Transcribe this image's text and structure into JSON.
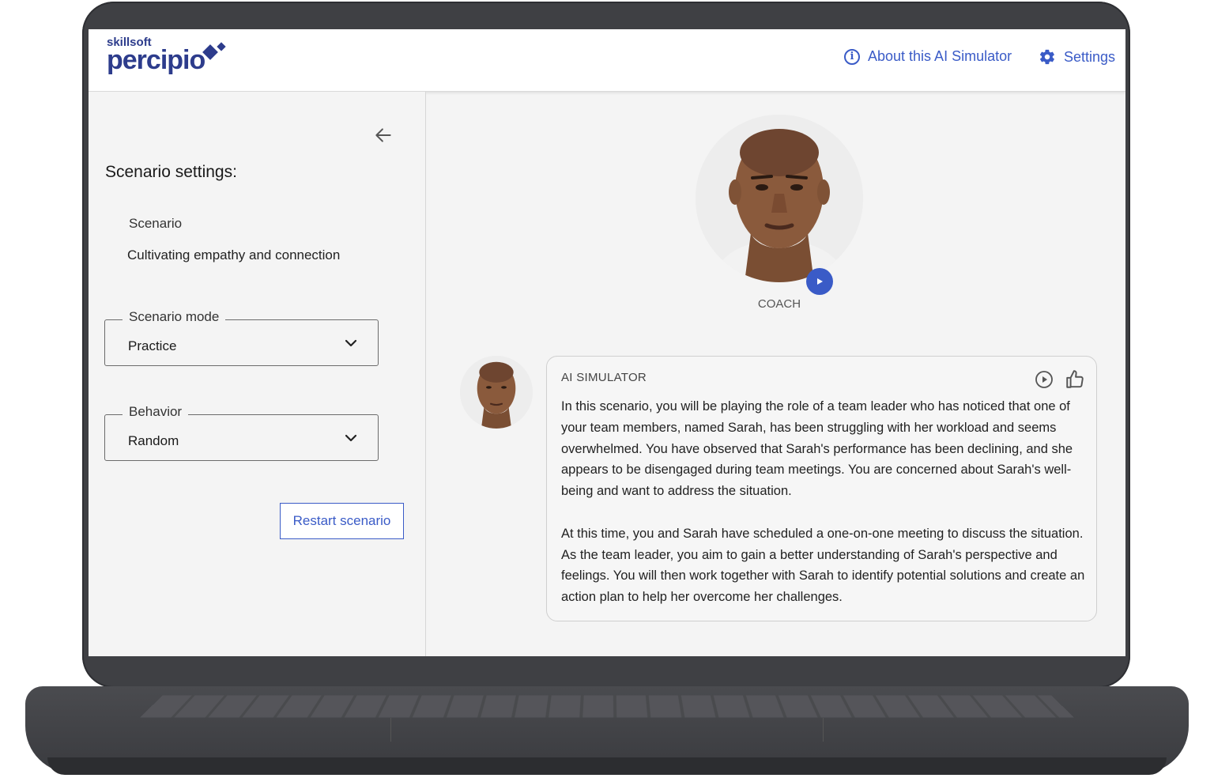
{
  "header": {
    "logo_small": "skillsoft",
    "logo_main": "percipio",
    "about_label": "About this AI Simulator",
    "settings_label": "Settings"
  },
  "sidebar": {
    "title": "Scenario settings:",
    "scenario_label": "Scenario",
    "scenario_value": "Cultivating empathy and connection",
    "mode_label": "Scenario mode",
    "mode_value": "Practice",
    "behavior_label": "Behavior",
    "behavior_value": "Random",
    "restart_label": "Restart scenario"
  },
  "coach": {
    "label": "COACH"
  },
  "message": {
    "sender": "AI SIMULATOR",
    "paragraph_1": "In this scenario, you will be playing the role of a team leader who has noticed that one of your team members, named Sarah, has been struggling with her workload and seems overwhelmed. You have observed that Sarah's performance has been declining, and she appears to be disengaged during team meetings. You are concerned about Sarah's well-being and want to address the situation.",
    "paragraph_2": "At this time, you and Sarah have scheduled a one-on-one meeting to discuss the situation. As the team leader, you aim to gain a better understanding of Sarah's perspective and feelings. You will then work together with Sarah to identify potential solutions and create an action plan to help her overcome her challenges."
  },
  "colors": {
    "accent": "#3a5bc7",
    "brand": "#2d3c8c",
    "laptop_body": "#3f4044",
    "screen_bg": "#f4f4f4"
  },
  "icons": [
    "info-icon",
    "gear-icon",
    "arrow-left-icon",
    "chevron-down-icon",
    "play-icon",
    "thumbs-up-icon"
  ]
}
